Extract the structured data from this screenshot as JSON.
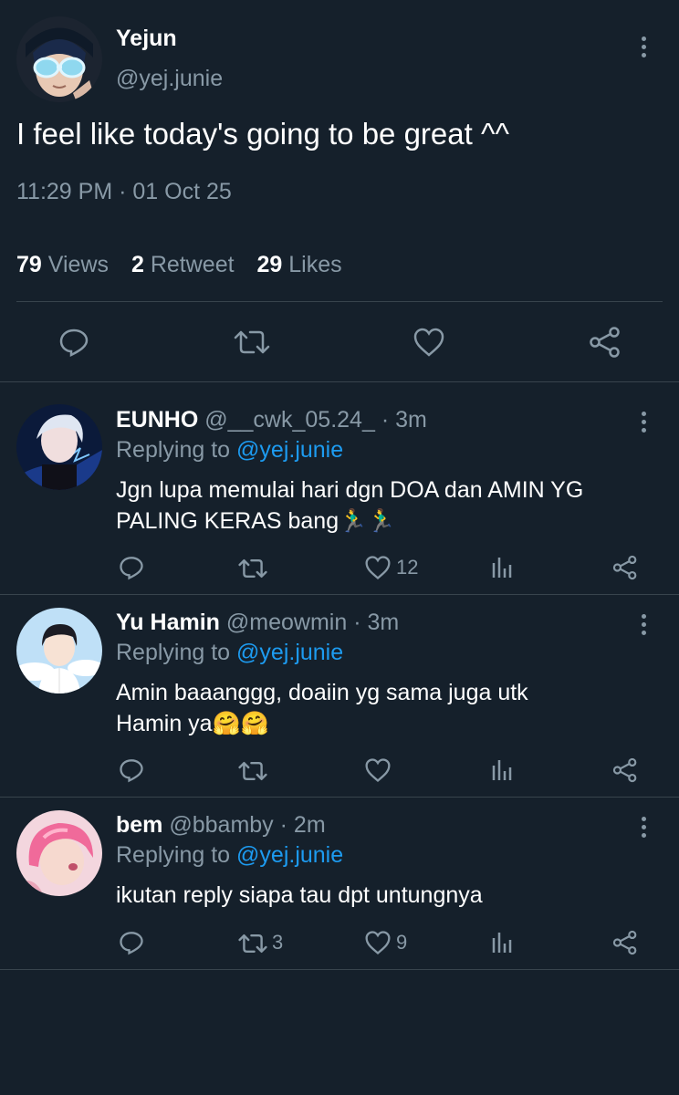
{
  "tweet": {
    "author_name": "Yejun",
    "author_handle": "@yej.junie",
    "text": "I feel like today's going to be great ^^",
    "timestamp": "11:29 PM · 01 Oct 25",
    "stats": {
      "views_count": "79",
      "views_label": "Views",
      "retweets_count": "2",
      "retweets_label": "Retweet",
      "likes_count": "29",
      "likes_label": "Likes"
    }
  },
  "replies": [
    {
      "name": "EUNHO",
      "handle": "@__cwk_05.24_",
      "time": "· 3m",
      "replying_label": "Replying to",
      "replying_handle": "@yej.junie",
      "text_line1": "Jgn lupa memulai hari dgn DOA dan AMIN YG",
      "text_line2": "PALING KERAS bang🏃‍♂️🏃‍♂️",
      "retweets": "",
      "likes": "12"
    },
    {
      "name": "Yu Hamin",
      "handle": "@meowmin",
      "time": "· 3m",
      "replying_label": "Replying to",
      "replying_handle": "@yej.junie",
      "text_line1": "Amin baaanggg, doaiin yg sama juga utk",
      "text_line2": "Hamin ya🤗🤗",
      "retweets": "",
      "likes": ""
    },
    {
      "name": "bem",
      "handle": "@bbamby",
      "time": "· 2m",
      "replying_label": "Replying to",
      "replying_handle": "@yej.junie",
      "text_line1": "ikutan reply siapa tau dpt untungnya",
      "text_line2": "",
      "retweets": "3",
      "likes": "9"
    }
  ],
  "icons": {
    "reply": "speech-bubble-icon",
    "retweet": "retweet-arrows-icon",
    "like": "heart-icon",
    "share": "share-nodes-icon",
    "analytics": "bar-chart-icon",
    "more": "vertical-ellipsis-icon"
  },
  "colors": {
    "background": "#15202b",
    "muted": "#8899a6",
    "link": "#1d9bf0",
    "divider": "#38444d"
  }
}
